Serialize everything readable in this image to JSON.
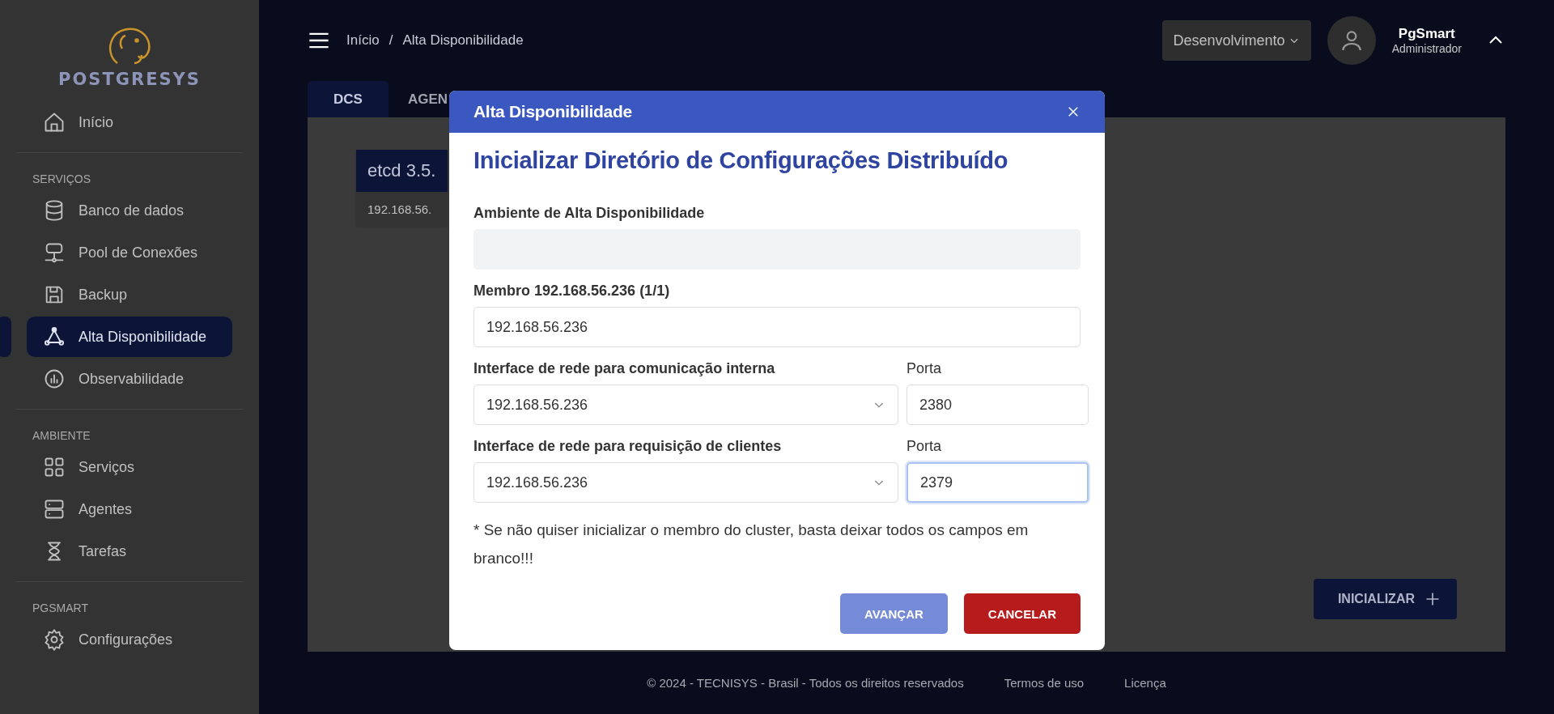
{
  "sidebar": {
    "logo_text": "POSTGRESYS",
    "sections": [
      {
        "items": [
          {
            "label": "Início",
            "selected": false
          }
        ]
      },
      {
        "heading": "SERVIÇOS",
        "items": [
          {
            "label": "Banco de dados",
            "selected": false
          },
          {
            "label": "Pool de Conexões",
            "selected": false
          },
          {
            "label": "Backup",
            "selected": false
          },
          {
            "label": "Alta Disponibilidade",
            "selected": true
          },
          {
            "label": "Observabilidade",
            "selected": false
          }
        ]
      },
      {
        "heading": "AMBIENTE",
        "items": [
          {
            "label": "Serviços",
            "selected": false
          },
          {
            "label": "Agentes",
            "selected": false
          },
          {
            "label": "Tarefas",
            "selected": false
          }
        ]
      },
      {
        "heading": "PGSMART",
        "items": [
          {
            "label": "Configurações",
            "selected": false
          }
        ]
      }
    ]
  },
  "header": {
    "breadcrumb": {
      "items": [
        "Início",
        "Alta Disponibilidade"
      ],
      "separator": "/"
    },
    "environment": "Desenvolvimento",
    "user_name": "PgSmart",
    "user_role": "Administrador"
  },
  "tabs": [
    {
      "label": "DCS",
      "selected": true
    },
    {
      "label": "AGEN",
      "selected": false
    }
  ],
  "card": {
    "title": "etcd 3.5.",
    "address": "192.168.56."
  },
  "initialize_button": "INICIALIZAR",
  "footer": {
    "copyright": "© 2024 - TECNISYS - Brasil - Todos os direitos reservados",
    "links": [
      "Termos de uso",
      "Licença"
    ]
  },
  "modal": {
    "title": "Alta Disponibilidade",
    "heading": "Inicializar Diretório de Configurações Distribuído",
    "fields": [
      {
        "kind": "text",
        "label": "Ambiente de Alta Disponibilidade",
        "disabled": true
      },
      {
        "kind": "text",
        "label": "Membro 192.168.56.236 (1/1)",
        "value": "192.168.56.236",
        "disabled": false
      },
      {
        "kind": "select_port",
        "label": "Interface de rede para comunicação interna",
        "value": "192.168.56.236",
        "port_label": "Porta",
        "port_value": "2380",
        "port_focused": false
      },
      {
        "kind": "select_port",
        "label": "Interface de rede para requisição de clientes",
        "value": "192.168.56.236",
        "port_label": "Porta",
        "port_value": "2379",
        "port_focused": true
      }
    ],
    "note": "* Se não quiser inicializar o membro do cluster, basta deixar todos os campos em branco!!!",
    "buttons": [
      {
        "label": "AVANÇAR",
        "kind": "primary",
        "disabled": true
      },
      {
        "label": "CANCELAR",
        "kind": "danger",
        "disabled": false
      }
    ]
  }
}
